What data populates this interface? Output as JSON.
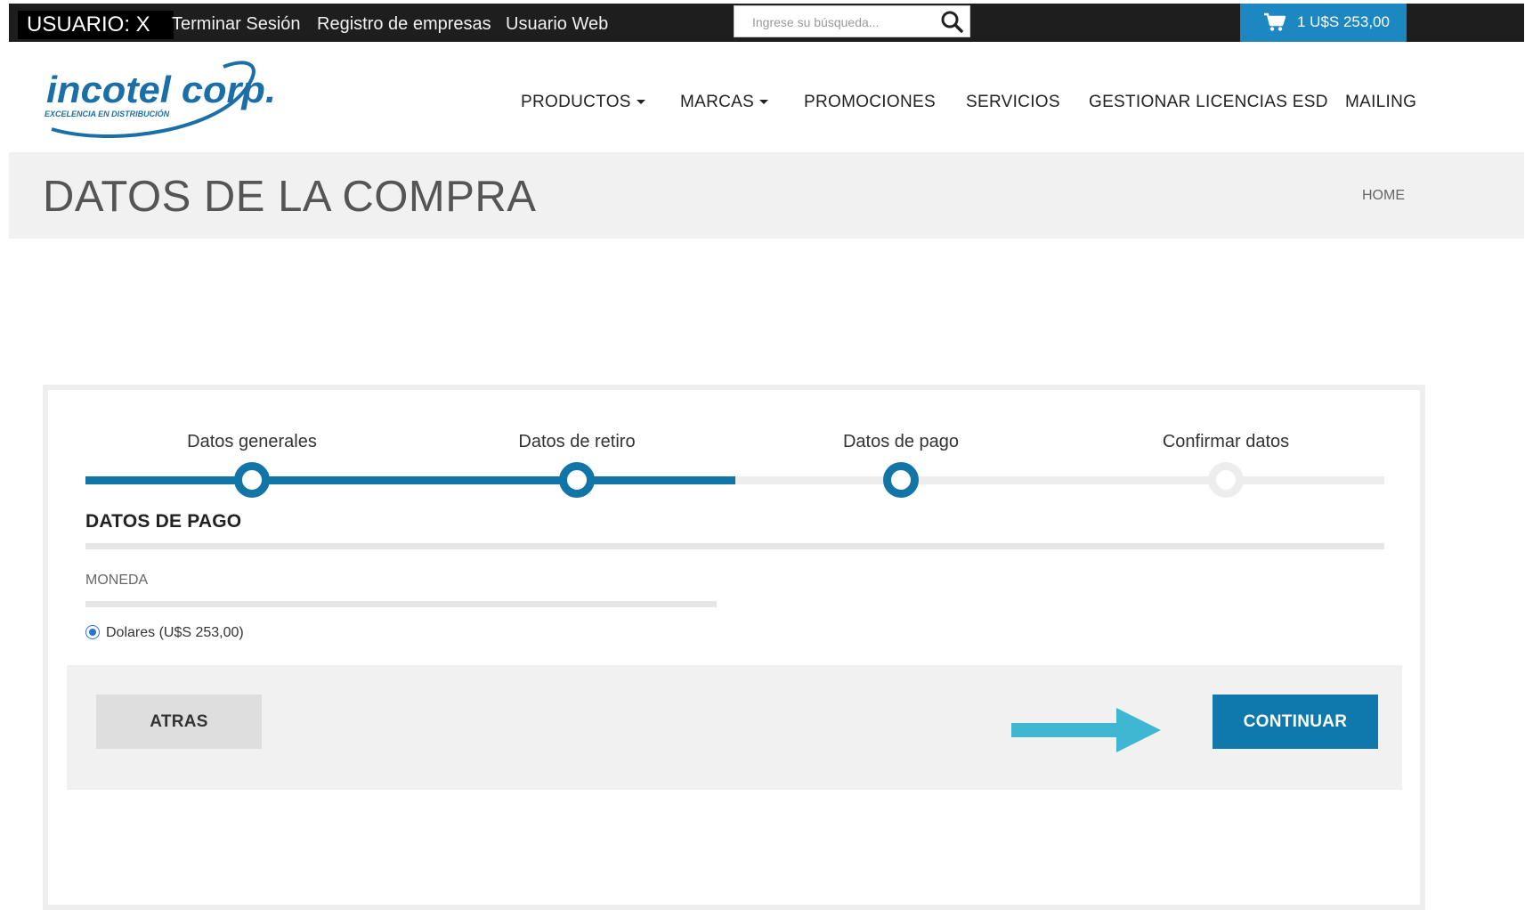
{
  "topbar": {
    "user_label": "USUARIO: X",
    "links": [
      "Terminar Sesión",
      "Registro de empresas",
      "Usuario Web"
    ],
    "search_placeholder": "Ingrese su búsqueda...",
    "cart_text": "1 U$S 253,00"
  },
  "logo": {
    "brand": "incotel corp.",
    "tagline": "EXCELENCIA EN DISTRIBUCIÓN"
  },
  "nav": {
    "items": [
      "PRODUCTOS",
      "MARCAS",
      "PROMOCIONES",
      "SERVICIOS",
      "GESTIONAR LICENCIAS ESD",
      "MAILING"
    ]
  },
  "page": {
    "title": "DATOS DE LA COMPRA",
    "breadcrumb": "HOME"
  },
  "steps": [
    {
      "label": "Datos generales",
      "done": true
    },
    {
      "label": "Datos de retiro",
      "done": true
    },
    {
      "label": "Datos de pago",
      "done": true
    },
    {
      "label": "Confirmar datos",
      "done": false
    }
  ],
  "payment": {
    "section_title": "DATOS DE PAGO",
    "currency_label": "MONEDA",
    "option_label": "Dolares (U$S 253,00)"
  },
  "actions": {
    "back_label": "ATRAS",
    "continue_label": "CONTINUAR"
  },
  "colors": {
    "accent": "#1175a8",
    "cart_bg": "#1d87c2",
    "arrow": "#3fb7d3"
  }
}
